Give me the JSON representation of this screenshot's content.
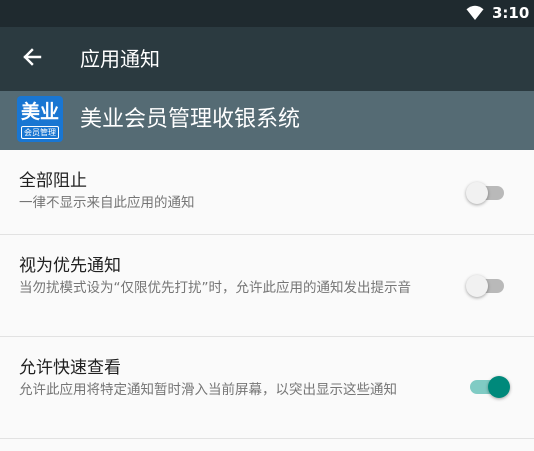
{
  "status_bar": {
    "time": "3:10",
    "wifi_icon": "wifi-icon"
  },
  "toolbar": {
    "back_icon": "arrow-back-icon",
    "title": "应用通知"
  },
  "app": {
    "icon": {
      "line1": "美业",
      "line2": "会员管理"
    },
    "name": "美业会员管理收银系统"
  },
  "settings": [
    {
      "title": "全部阻止",
      "subtitle": "一律不显示来自此应用的通知",
      "enabled": false
    },
    {
      "title": "视为优先通知",
      "subtitle": "当勿扰模式设为“仅限优先打扰”时，允许此应用的通知发出提示音",
      "enabled": false
    },
    {
      "title": "允许快速查看",
      "subtitle": "允许此应用将特定通知暂时滑入当前屏幕，以突出显示这些通知",
      "enabled": true
    }
  ],
  "colors": {
    "status_bar": "#1f2a2f",
    "toolbar": "#2b3a40",
    "app_header": "#556b74",
    "switch_on": "#00897b",
    "switch_off": "#b9b9b9"
  }
}
